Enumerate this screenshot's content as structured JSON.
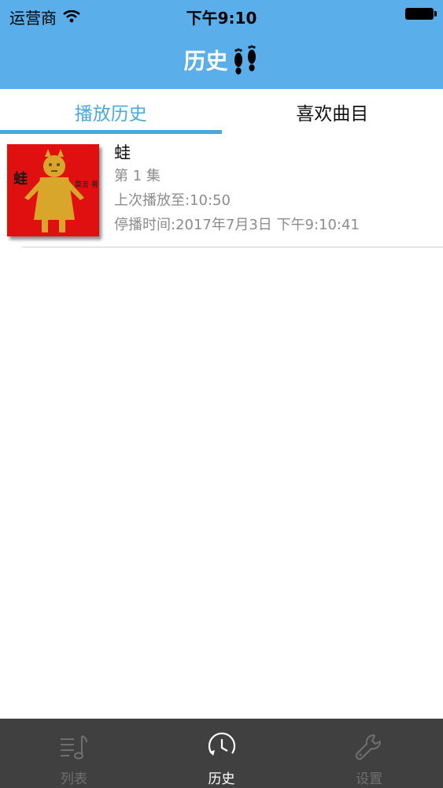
{
  "status": {
    "carrier": "运营商",
    "time": "下午9:10"
  },
  "nav": {
    "title": "历史"
  },
  "tabs": [
    {
      "label": "播放历史",
      "active": true
    },
    {
      "label": "喜欢曲目",
      "active": false
    }
  ],
  "history": [
    {
      "cover_title": "蛙",
      "cover_author": "莫言 著",
      "title": "蛙",
      "episode": "第 1 集",
      "last_played": "上次播放至:10:50",
      "stop_time": "停播时间:2017年7月3日 下午9:10:41"
    }
  ],
  "tabbar": [
    {
      "label": "列表",
      "icon": "music-list-icon",
      "active": false
    },
    {
      "label": "历史",
      "icon": "clock-icon",
      "active": true
    },
    {
      "label": "设置",
      "icon": "wrench-icon",
      "active": false
    }
  ]
}
